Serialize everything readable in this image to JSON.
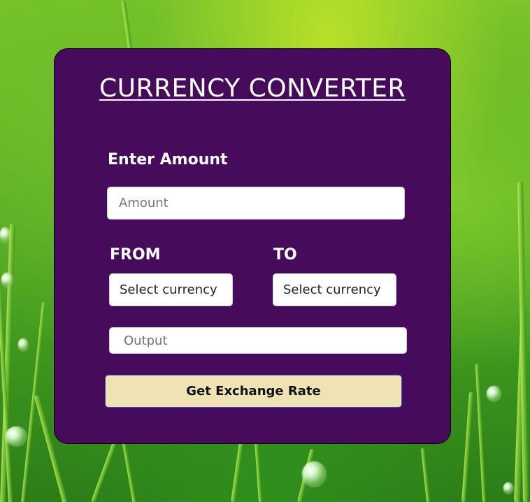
{
  "app": {
    "title": "CURRENCY CONVERTER"
  },
  "form": {
    "amount_label": "Enter Amount",
    "amount_placeholder": "Amount",
    "amount_value": "",
    "from_label": "FROM",
    "to_label": "TO",
    "from_selected": "Select currency",
    "to_selected": "Select currency",
    "output_placeholder": "Output",
    "output_value": "",
    "button_label": "Get Exchange Rate"
  },
  "colors": {
    "card_bg": "#470b5c",
    "button_bg": "#efe3b5",
    "button_border": "#3b4fc7",
    "text_light": "#ffffff"
  }
}
